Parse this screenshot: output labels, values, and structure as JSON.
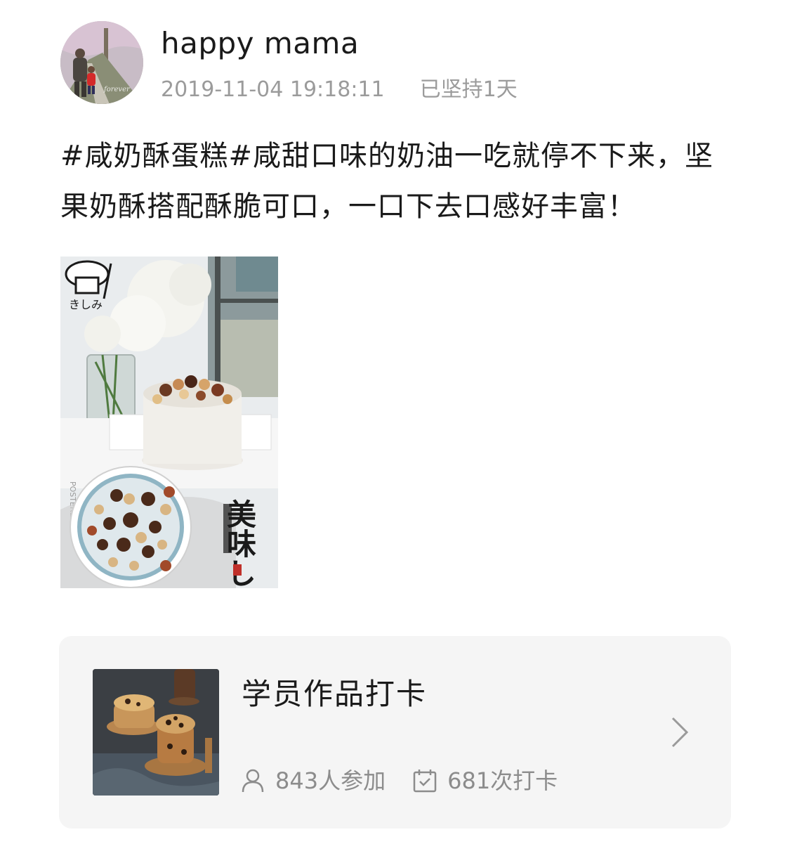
{
  "post": {
    "username": "happy mama",
    "timestamp": "2019-11-04 19:18:11",
    "streak": "已坚持1天",
    "text": "#咸奶酥蛋糕#咸甜口味的奶油一吃就停不下来，坚果奶酥搭配酥脆可口，一口下去口感好丰富！",
    "image": {
      "watermark_vertical": "POSTERLABS",
      "calligraphy": "美味しい",
      "badge_text": "きしみ"
    }
  },
  "card": {
    "title": "学员作品打卡",
    "participants": "843人参加",
    "checkins": "681次打卡",
    "icons": [
      "person-icon",
      "calendar-check-icon",
      "chevron-right-icon"
    ]
  },
  "colors": {
    "text_primary": "#1a1a1a",
    "text_secondary": "#9b9b9b",
    "card_bg": "#f5f5f5"
  }
}
